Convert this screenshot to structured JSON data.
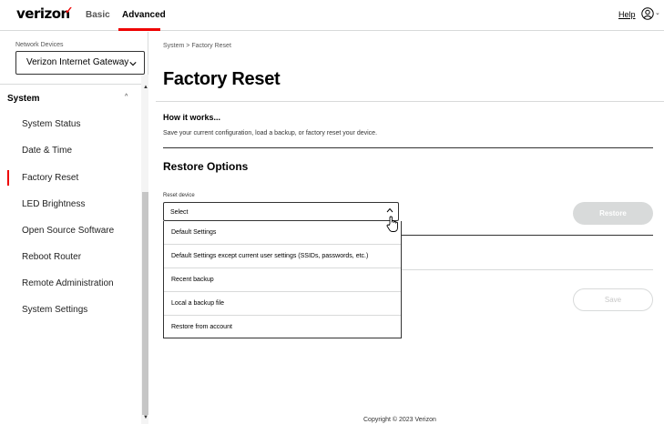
{
  "header": {
    "logo_text": "verizon",
    "logo_check": "✓",
    "tabs": [
      {
        "label": "Basic"
      },
      {
        "label": "Advanced"
      }
    ],
    "help_label": "Help",
    "accent_color": "#ee0000"
  },
  "sidebar": {
    "network_devices_label": "Network Devices",
    "device_selected": "Verizon Internet Gateway",
    "section_label": "System",
    "items": [
      {
        "label": "System Status"
      },
      {
        "label": "Date & Time"
      },
      {
        "label": "Factory Reset"
      },
      {
        "label": "LED Brightness"
      },
      {
        "label": "Open Source Software"
      },
      {
        "label": "Reboot Router"
      },
      {
        "label": "Remote Administration"
      },
      {
        "label": "System Settings"
      }
    ],
    "active_item": "Factory Reset"
  },
  "main": {
    "breadcrumb": "System  >  Factory Reset",
    "title": "Factory Reset",
    "how_title": "How it works...",
    "how_desc": "Save your current configuration, load a backup, or factory reset your device.",
    "restore_title": "Restore Options",
    "reset_label": "Reset device",
    "reset_selected": "Select",
    "restore_button": "Restore",
    "save_button": "Save",
    "dropdown_options": [
      {
        "label": "Default Settings"
      },
      {
        "label": "Default Settings except current user settings (SSIDs, passwords, etc.)"
      },
      {
        "label": "Recent backup"
      },
      {
        "label": "Local a backup file"
      },
      {
        "label": "Restore from account"
      }
    ]
  },
  "footer": {
    "copyright": "Copyright © 2023 Verizon"
  }
}
